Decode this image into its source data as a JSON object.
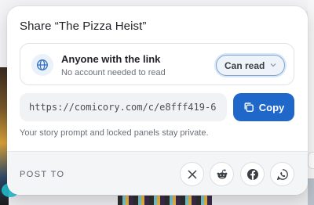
{
  "dialog": {
    "title": "Share “The Pizza Heist”"
  },
  "access": {
    "title": "Anyone with the link",
    "subtitle": "No account needed to read",
    "permission": "Can read",
    "icon": "globe-icon"
  },
  "link": {
    "value": "https://comicory.com/c/e8fff419-6"
  },
  "copy": {
    "label": "Copy",
    "icon": "copy-icon"
  },
  "privacy_note": "Your story prompt and locked panels stay private.",
  "post": {
    "label": "POST TO",
    "targets": [
      {
        "name": "X",
        "icon": "x-icon"
      },
      {
        "name": "Reddit",
        "icon": "reddit-icon"
      },
      {
        "name": "Facebook",
        "icon": "facebook-icon"
      },
      {
        "name": "WhatsApp",
        "icon": "whatsapp-icon"
      }
    ]
  },
  "colors": {
    "accent": "#1f68c9",
    "select_border": "#7fa6d8",
    "muted_text": "#6b7079"
  }
}
